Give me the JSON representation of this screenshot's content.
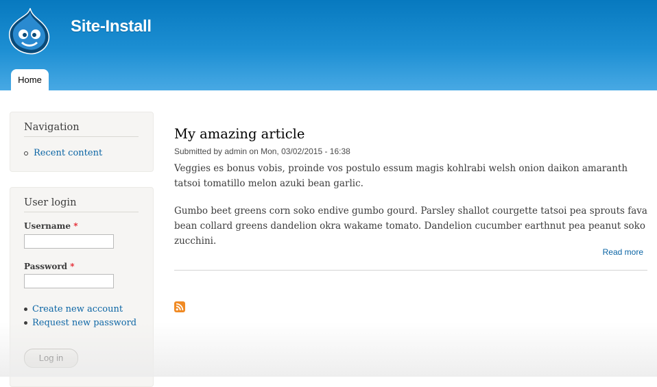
{
  "site": {
    "name": "Site-Install"
  },
  "tabs": [
    {
      "label": "Home"
    }
  ],
  "sidebar": {
    "navigation": {
      "title": "Navigation",
      "items": [
        {
          "label": "Recent content"
        }
      ]
    },
    "user_login": {
      "title": "User login",
      "username_label": "Username",
      "password_label": "Password",
      "required_mark": "*",
      "username_value": "",
      "password_value": "",
      "links": [
        {
          "label": "Create new account"
        },
        {
          "label": "Request new password"
        }
      ],
      "submit_label": "Log in"
    }
  },
  "main": {
    "article": {
      "title": "My amazing article",
      "submitted": "Submitted by admin on Mon, 03/02/2015 - 16:38",
      "paragraphs": [
        "Veggies es bonus vobis, proinde vos postulo essum magis kohlrabi welsh onion daikon amaranth tatsoi tomatillo melon azuki bean garlic.",
        "Gumbo beet greens corn soko endive gumbo gourd. Parsley shallot courgette tatsoi pea sprouts fava bean collard greens dandelion okra wakame tomato. Dandelion cucumber earthnut pea peanut soko zucchini."
      ],
      "read_more": "Read more"
    }
  },
  "icons": {
    "logo": "drupal-drop-logo",
    "feed": "rss-feed-icon"
  },
  "colors": {
    "header_top": "#0779bf",
    "header_bottom": "#48a9e4",
    "link": "#0a64a4",
    "required": "#e4202a",
    "rss": "#f08a24"
  }
}
